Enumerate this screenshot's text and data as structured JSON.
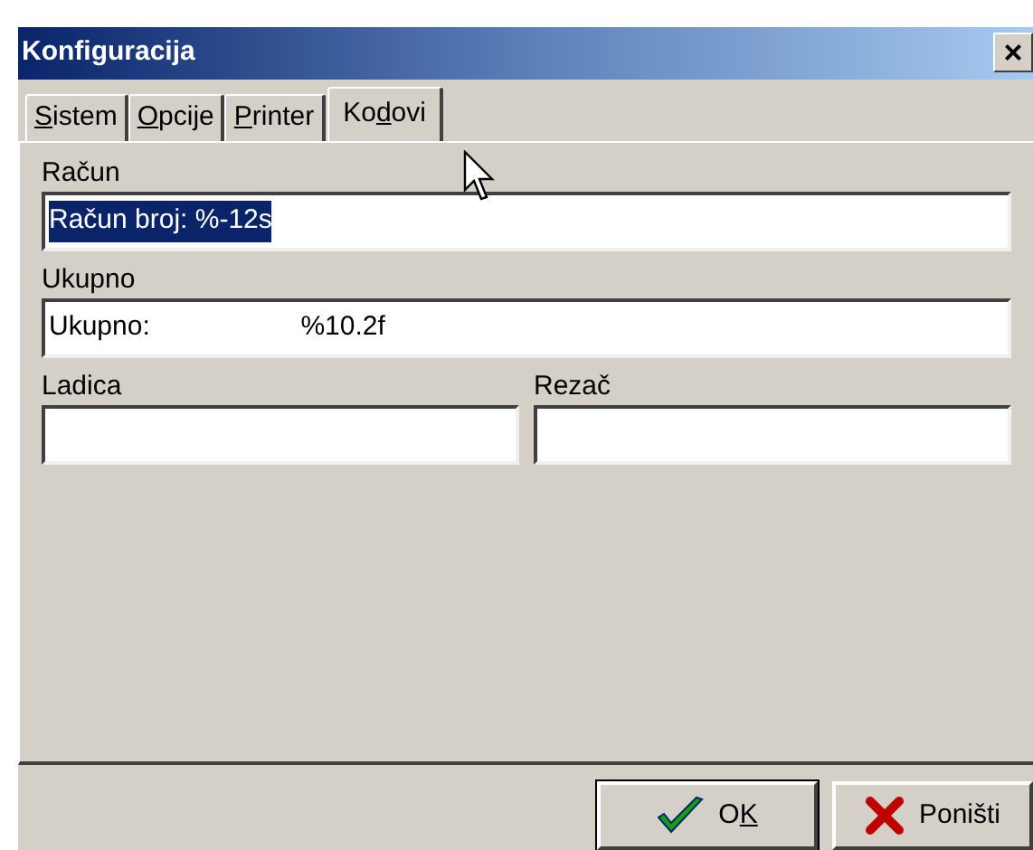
{
  "window": {
    "title": "Konfiguracija",
    "close": "×"
  },
  "tabs": [
    {
      "label_parts": [
        {
          "text": "S",
          "underlined": true
        },
        {
          "text": "istem",
          "underlined": false
        }
      ],
      "selected": false
    },
    {
      "label_parts": [
        {
          "text": "O",
          "underlined": true
        },
        {
          "text": "pcije",
          "underlined": false
        }
      ],
      "selected": false
    },
    {
      "label_parts": [
        {
          "text": "P",
          "underlined": true
        },
        {
          "text": "rinter",
          "underlined": false
        }
      ],
      "selected": false
    },
    {
      "label_parts": [
        {
          "text": "Ko",
          "underlined": false
        },
        {
          "text": "d",
          "underlined": true
        },
        {
          "text": "ovi",
          "underlined": false
        }
      ],
      "selected": true
    }
  ],
  "fields": [
    {
      "label": "Račun",
      "value": "Račun broj: %-12s",
      "text_selected": true,
      "kind": "wide"
    },
    {
      "label": "Ukupno",
      "value": "Ukupno:                    %10.2f",
      "text_selected": false,
      "kind": "wide"
    },
    {
      "label": "Ladica",
      "text_selected": false,
      "kind": "narrow"
    },
    {
      "label": "Rezač",
      "text_selected": false,
      "kind": "narrow"
    }
  ],
  "buttons": [
    {
      "label_parts": [
        {
          "text": "O",
          "underlined": false
        },
        {
          "text": "K",
          "underlined": true
        }
      ],
      "kind": "ok"
    },
    {
      "label_parts": [
        {
          "text": "Poništi",
          "underlined": false
        }
      ],
      "kind": "cancel"
    }
  ]
}
